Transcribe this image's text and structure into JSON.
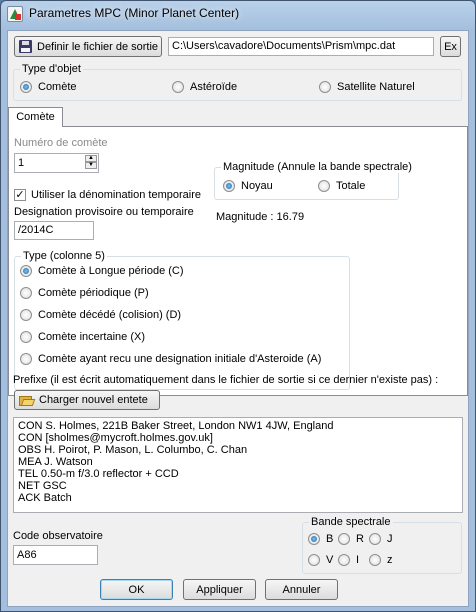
{
  "window": {
    "title": "Parametres MPC (Minor Planet Center)"
  },
  "output": {
    "define_button": "Definir le fichier de sortie",
    "path": "C:\\Users\\cavadore\\Documents\\Prism\\mpc.dat",
    "ex_button": "Ex"
  },
  "object_type": {
    "legend": "Type d'objet",
    "options": [
      "Comète",
      "Astéroïde",
      "Satellite Naturel"
    ],
    "selected": "Comète"
  },
  "tab": {
    "label": "Comète"
  },
  "comet": {
    "number_label": "Numéro de comète",
    "number_value": "1",
    "temp_checkbox_label": "Utiliser la dénomination temporaire",
    "temp_checked": true,
    "designation_label": "Designation provisoire ou temporaire",
    "designation_value": "/2014C"
  },
  "magnitude": {
    "legend": "Magnitude (Annule la bande spectrale)",
    "options": [
      "Noyau",
      "Totale"
    ],
    "selected": "Noyau",
    "readout": "Magnitude : 16.79"
  },
  "type_col5": {
    "legend": "Type (colonne 5)",
    "options": [
      "Comète à Longue période (C)",
      "Comète périodique (P)",
      "Comète décédé (colision) (D)",
      "Comète incertaine (X)",
      "Comète ayant recu une designation initiale d'Asteroide (A)"
    ],
    "selected": "Comète à Longue période (C)"
  },
  "prefix": {
    "label": "Prefixe (il est écrit automatiquement dans le fichier de sortie si ce dernier n'existe pas) :",
    "load_button": "Charger nouvel entete",
    "lines": [
      "CON S. Holmes, 221B Baker Street, London NW1 4JW, England",
      "CON [sholmes@mycroft.holmes.gov.uk]",
      "OBS H. Poirot, P. Mason, L. Columbo, C. Chan",
      "MEA J. Watson",
      "TEL 0.50-m f/3.0 reflector + CCD",
      "NET GSC",
      "ACK Batch"
    ]
  },
  "observatory": {
    "label": "Code observatoire",
    "value": "A86"
  },
  "band": {
    "legend": "Bande spectrale",
    "options": [
      "B",
      "R",
      "J",
      "V",
      "I",
      "z"
    ],
    "selected": "B"
  },
  "footer": {
    "ok": "OK",
    "apply": "Appliquer",
    "cancel": "Annuler"
  },
  "icons": {
    "app": "app-icon",
    "folder": "folder-open-icon",
    "floppy": "floppy-disk-icon"
  }
}
